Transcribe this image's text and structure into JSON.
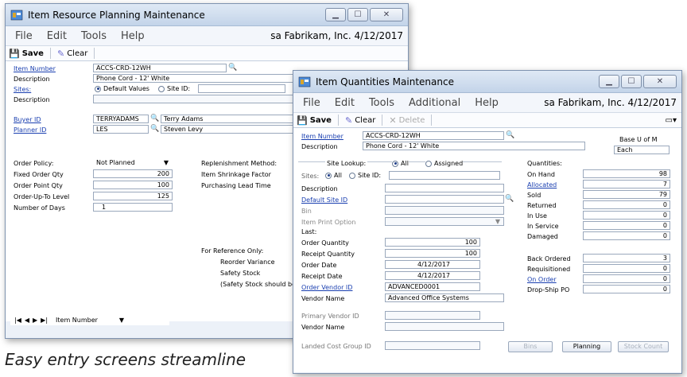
{
  "win1": {
    "title": "Item Resource Planning Maintenance",
    "menu": [
      "File",
      "Edit",
      "Tools",
      "Help"
    ],
    "company": "sa  Fabrikam, Inc.  4/12/2017",
    "toolbar": {
      "save": "Save",
      "clear": "Clear"
    },
    "item_number_label": "Item Number",
    "item_number": "ACCS-CRD-12WH",
    "description_label": "Description",
    "description": "Phone Cord - 12' White",
    "sites_label": "Sites:",
    "default_values": "Default Values",
    "site_id": "Site ID:",
    "description2_label": "Description",
    "buyer_id_label": "Buyer ID",
    "buyer_id": "TERRYADAMS",
    "buyer_name": "Terry Adams",
    "planner_id_label": "Planner ID",
    "planner_id": "LES",
    "planner_name": "Steven Levy",
    "order_policy_label": "Order Policy:",
    "order_policy": "Not Planned",
    "fixed_order_qty_label": "Fixed Order Qty",
    "fixed_order_qty": "200",
    "order_point_qty_label": "Order Point Qty",
    "order_point_qty": "100",
    "order_up_to_label": "Order-Up-To Level",
    "order_up_to": "125",
    "num_days_label": "Number of Days",
    "num_days": "1",
    "replenishment_label": "Replenishment Method:",
    "shrinkage_label": "Item Shrinkage Factor",
    "purchasing_label": "Purchasing Lead Time",
    "reference_label": "For Reference Only:",
    "reorder_variance": "Reorder Variance",
    "safety_stock": "Safety Stock",
    "safety_note": "(Safety Stock should be i",
    "nav_sort": "Item Number"
  },
  "win2": {
    "title": "Item Quantities Maintenance",
    "menu": [
      "File",
      "Edit",
      "Tools",
      "Additional",
      "Help"
    ],
    "company": "sa  Fabrikam, Inc.  4/12/2017",
    "toolbar": {
      "save": "Save",
      "clear": "Clear",
      "delete": "Delete"
    },
    "item_number_label": "Item Number",
    "item_number": "ACCS-CRD-12WH",
    "description_label": "Description",
    "description": "Phone Cord - 12' White",
    "base_uom_label": "Base U of M",
    "base_uom": "Each",
    "site_lookup": "Site Lookup:",
    "lookup_all": "All",
    "lookup_assigned": "Assigned",
    "sites_label": "Sites:",
    "sites_all": "All",
    "site_id": "Site ID:",
    "left_labels": {
      "description": "Description",
      "default_site": "Default Site ID",
      "bin": "Bin",
      "item_print": "Item Print Option",
      "last": "Last:",
      "order_qty": "Order Quantity",
      "receipt_qty": "Receipt Quantity",
      "order_date": "Order Date",
      "receipt_date": "Receipt Date",
      "order_vendor": "Order Vendor ID",
      "vendor_name": "Vendor Name",
      "primary_vendor": "Primary Vendor ID",
      "vendor_name2": "Vendor Name",
      "landed_cost": "Landed Cost Group ID"
    },
    "values": {
      "order_qty": "100",
      "receipt_qty": "100",
      "order_date": "4/12/2017",
      "receipt_date": "4/12/2017",
      "order_vendor": "ADVANCED0001",
      "vendor_name": "Advanced Office Systems"
    },
    "quantities_label": "Quantities:",
    "quantities": [
      {
        "label": "On Hand",
        "value": "98",
        "link": false
      },
      {
        "label": "Allocated",
        "value": "7",
        "link": true
      },
      {
        "label": "Sold",
        "value": "79",
        "link": false
      },
      {
        "label": "Returned",
        "value": "0",
        "link": false
      },
      {
        "label": "In Use",
        "value": "0",
        "link": false
      },
      {
        "label": "In Service",
        "value": "0",
        "link": false
      },
      {
        "label": "Damaged",
        "value": "0",
        "link": false
      }
    ],
    "quantities2": [
      {
        "label": "Back Ordered",
        "value": "3",
        "link": false
      },
      {
        "label": "Requisitioned",
        "value": "0",
        "link": false
      },
      {
        "label": "On Order",
        "value": "0",
        "link": true
      },
      {
        "label": "Drop-Ship PO",
        "value": "0",
        "link": false
      }
    ],
    "buttons": {
      "bins": "Bins",
      "planning": "Planning",
      "stock_count": "Stock Count"
    }
  },
  "caption": "Easy entry screens streamline"
}
